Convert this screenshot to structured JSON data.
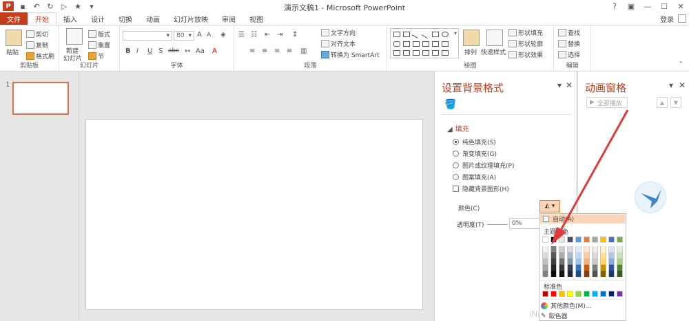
{
  "titlebar": {
    "app_icon": "P",
    "title": "演示文稿1 - Microsoft PowerPoint",
    "controls": [
      "?",
      "▣",
      "—",
      "☐",
      "✕"
    ]
  },
  "tabs": {
    "file": "文件",
    "items": [
      "开始",
      "插入",
      "设计",
      "切换",
      "动画",
      "幻灯片放映",
      "审阅",
      "视图"
    ],
    "login": "登录"
  },
  "ribbon": {
    "clipboard": {
      "paste": "粘贴",
      "cut": "剪切",
      "copy": "复制",
      "painter": "格式刷",
      "label": "剪贴板"
    },
    "slides": {
      "new_slide": "新建",
      "new_slide2": "幻灯片",
      "layout": "版式",
      "reset": "重置",
      "section": "节",
      "label": "幻灯片"
    },
    "font": {
      "size": "80",
      "label": "字体",
      "bold": "B",
      "italic": "I",
      "underline": "U",
      "shadow": "S",
      "strike": "abc",
      "aa": "Aa",
      "grow": "A",
      "shrink": "A"
    },
    "paragraph": {
      "text_dir": "文字方向",
      "align_text": "对齐文本",
      "smartart": "转换为 SmartArt",
      "label": "段落"
    },
    "drawing": {
      "arrange": "排列",
      "quick_styles": "快速样式",
      "shape_fill": "形状填充",
      "shape_outline": "形状轮廓",
      "shape_effects": "形状效果",
      "label": "绘图"
    },
    "editing": {
      "find": "查找",
      "replace": "替换",
      "select": "选择",
      "label": "编辑"
    }
  },
  "thumbnails": {
    "number": "1"
  },
  "format_pane": {
    "title": "设置背景格式",
    "section": "填充",
    "options": [
      {
        "label": "纯色填充(S)",
        "checked": true
      },
      {
        "label": "渐变填充(G)",
        "checked": false
      },
      {
        "label": "图片或纹理填充(P)",
        "checked": false
      },
      {
        "label": "图案填充(A)",
        "checked": false
      }
    ],
    "hide_graphics": "隐藏背景图形(H)",
    "color_label": "颜色(C)",
    "transparency_label": "透明度(T)",
    "transparency_value": "0%"
  },
  "color_menu": {
    "auto": "自动(A)",
    "theme_colors": "主题颜色",
    "standard_colors": "标准色",
    "more_colors": "其他颜色(M)...",
    "eyedropper": "取色器",
    "theme_top": [
      "#ffffff",
      "#000000",
      "#e7e6e6",
      "#44546a",
      "#5b9bd5",
      "#ed7d31",
      "#a5a5a5",
      "#ffc000",
      "#4472c4",
      "#70ad47"
    ],
    "theme_shades": [
      [
        "#f2f2f2",
        "#7f7f7f",
        "#d0cece",
        "#d6dce4",
        "#deebf6",
        "#fbe5d5",
        "#ededed",
        "#fff2cc",
        "#dae3f3",
        "#e2efd9"
      ],
      [
        "#d8d8d8",
        "#595959",
        "#aeabab",
        "#adb9ca",
        "#bdd7ee",
        "#f7cbac",
        "#dbdbdb",
        "#fee599",
        "#b4c6e7",
        "#c5e0b3"
      ],
      [
        "#bfbfbf",
        "#3f3f3f",
        "#757070",
        "#8496b0",
        "#9dc3e6",
        "#f4b183",
        "#c9c9c9",
        "#ffd965",
        "#8eaadb",
        "#a8d08d"
      ],
      [
        "#a5a5a5",
        "#262626",
        "#3a3838",
        "#323f4f",
        "#2e75b5",
        "#c55a11",
        "#7b7b7b",
        "#bf9000",
        "#2f5496",
        "#538135"
      ],
      [
        "#7f7f7f",
        "#0c0c0c",
        "#171616",
        "#222a35",
        "#1e4e79",
        "#833c0b",
        "#525252",
        "#7f6000",
        "#1f3864",
        "#375623"
      ]
    ],
    "standard": [
      "#c00000",
      "#ff0000",
      "#ffc000",
      "#ffff00",
      "#92d050",
      "#00b050",
      "#00b0f0",
      "#0070c0",
      "#002060",
      "#7030a0"
    ]
  },
  "animation_pane": {
    "title": "动画窗格",
    "play_all": "全部播放"
  },
  "watermark": "iNi"
}
